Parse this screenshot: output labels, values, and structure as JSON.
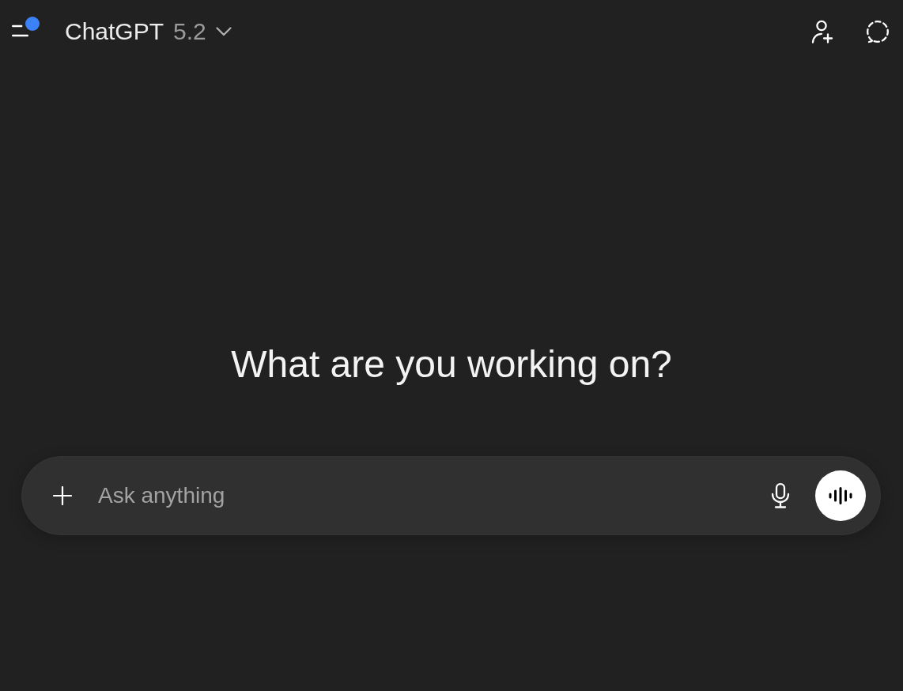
{
  "header": {
    "sidebar_button": {
      "notification": true
    },
    "model_selector": {
      "name": "ChatGPT",
      "version": "5.2"
    }
  },
  "greeting": "What are you working on?",
  "composer": {
    "placeholder": "Ask anything"
  }
}
